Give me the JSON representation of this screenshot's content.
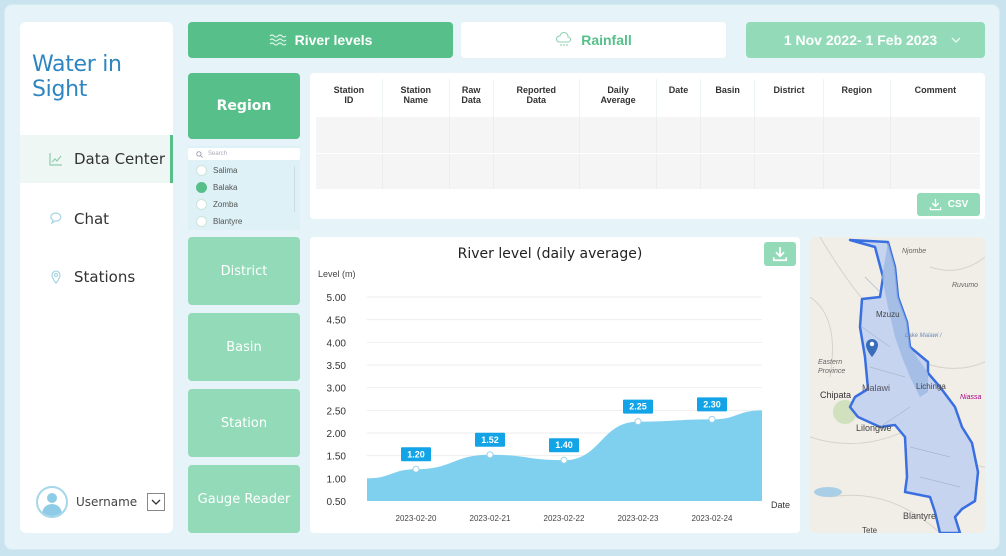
{
  "app": {
    "logo": "Water in Sight"
  },
  "sidebar": {
    "items": [
      {
        "label": "Data Center",
        "icon": "chart-line-icon",
        "active": true
      },
      {
        "label": "Chat",
        "icon": "chat-bubble-icon",
        "active": false
      },
      {
        "label": "Stations",
        "icon": "location-pin-icon",
        "active": false
      }
    ],
    "user": {
      "name": "Username"
    }
  },
  "tabs": {
    "river": "River levels",
    "rainfall": "Rainfall",
    "date_range": "1 Nov 2022- 1 Feb 2023"
  },
  "filters": {
    "region": "Region",
    "search_placeholder": "Search",
    "regions": [
      {
        "label": "Salima",
        "selected": false
      },
      {
        "label": "Balaka",
        "selected": true
      },
      {
        "label": "Zomba",
        "selected": false
      },
      {
        "label": "Blantyre",
        "selected": false
      }
    ],
    "district": "District",
    "basin": "Basin",
    "station": "Station",
    "gauge_reader": "Gauge Reader"
  },
  "table": {
    "columns": [
      [
        "Station",
        "ID"
      ],
      [
        "Station",
        "Name"
      ],
      [
        "Raw",
        "Data"
      ],
      [
        "Reported",
        "Data"
      ],
      [
        "Daily",
        "Average"
      ],
      [
        "Date",
        ""
      ],
      [
        "Basin",
        ""
      ],
      [
        "District",
        ""
      ],
      [
        "Region",
        ""
      ],
      [
        "Comment",
        ""
      ]
    ],
    "rows": [
      [
        "",
        "",
        "",
        "",
        "",
        "",
        "",
        "",
        "",
        ""
      ],
      [
        "",
        "",
        "",
        "",
        "",
        "",
        "",
        "",
        "",
        ""
      ]
    ],
    "csv_label": "CSV"
  },
  "chart_data": {
    "type": "area",
    "title": "River level (daily average)",
    "ylabel": "Level (m)",
    "xlabel": "Date",
    "ylim": [
      0.5,
      5.0
    ],
    "yticks": [
      "5.00",
      "4.50",
      "4.00",
      "3.50",
      "3.00",
      "2.50",
      "2.00",
      "1.50",
      "1.00",
      "0.50"
    ],
    "categories": [
      "2023-02-20",
      "2023-02-21",
      "2023-02-22",
      "2023-02-23",
      "2023-02-24"
    ],
    "values": [
      1.2,
      1.52,
      1.4,
      2.25,
      2.3
    ],
    "labels": [
      "1.20",
      "1.52",
      "1.40",
      "2.25",
      "2.30"
    ],
    "start_value": 1.0,
    "end_value": 2.5,
    "grid": true,
    "color": "#7fd0ef",
    "label_color": "#12a4e6"
  },
  "map": {
    "labels": [
      "Njombe",
      "Ruvuma",
      "Mzuzu",
      "Lake Malawi / Lake Nyasa",
      "Eastern Province",
      "Malawi",
      "Lichinga",
      "Niassa",
      "Chipata",
      "Lilongwe",
      "Blantyre",
      "Tete"
    ]
  },
  "colors": {
    "primary": "#57c08a",
    "primary_light": "#92dab8",
    "accent_blue": "#12a4e6"
  }
}
